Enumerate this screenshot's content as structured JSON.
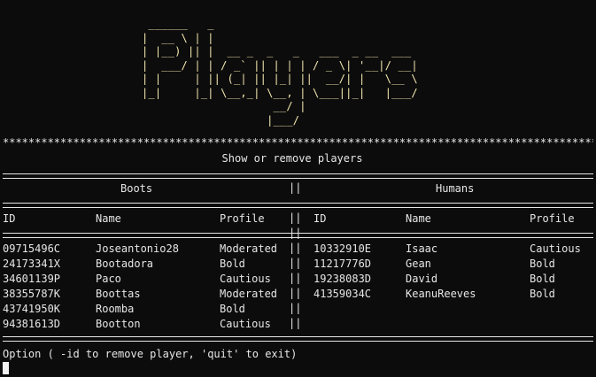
{
  "logo_text": "Players",
  "logo_art": " ______   _\n|  __ \\ | |\n| |__) || |  __ _  _   _   ___  _ __  ___\n|  ___/ | | / _` || | | | / _ \\| '__|/ __|\n| |     | || (_| || |_| ||  __/| |   \\__ \\\n|_|     |_| \\__,_| \\__, | \\___||_|   |___/\n                    __/ |\n                   |___/",
  "subtitle": "Show or remove players",
  "separator": "||",
  "boots": {
    "title": "Boots",
    "headers": {
      "id": "ID",
      "name": "Name",
      "profile": "Profile"
    },
    "rows": [
      {
        "id": "09715496C",
        "name": "Joseantonio28",
        "profile": "Moderated"
      },
      {
        "id": "24173341X",
        "name": "Bootadora",
        "profile": "Bold"
      },
      {
        "id": "34601139P",
        "name": "Paco",
        "profile": "Cautious"
      },
      {
        "id": "38355787K",
        "name": "Boottas",
        "profile": "Moderated"
      },
      {
        "id": "43741950K",
        "name": "Roomba",
        "profile": "Bold"
      },
      {
        "id": "94381613D",
        "name": "Bootton",
        "profile": "Cautious"
      }
    ]
  },
  "humans": {
    "title": "Humans",
    "headers": {
      "id": "ID",
      "name": "Name",
      "profile": "Profile"
    },
    "rows": [
      {
        "id": "10332910E",
        "name": "Isaac",
        "profile": "Cautious"
      },
      {
        "id": "11217776D",
        "name": "Gean",
        "profile": "Bold"
      },
      {
        "id": "19238083D",
        "name": "David",
        "profile": "Bold"
      },
      {
        "id": "41359034C",
        "name": "KeanuReeves",
        "profile": "Bold"
      }
    ]
  },
  "prompt": "Option ( -id to remove player, 'quit' to exit)"
}
